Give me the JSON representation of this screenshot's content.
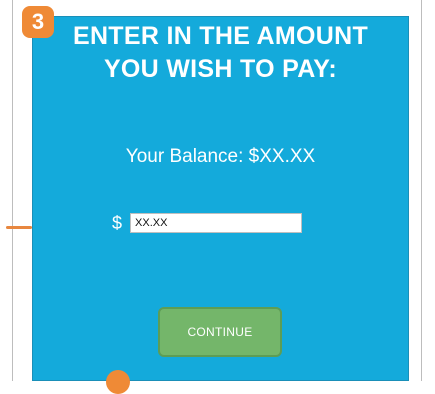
{
  "step": {
    "number": "3"
  },
  "header": {
    "title_line1": "ENTER IN THE AMOUNT",
    "title_line2": "YOU WISH TO PAY:"
  },
  "balance": {
    "text": "Your Balance: $XX.XX"
  },
  "payment": {
    "currency_symbol": "$",
    "amount_value": "XX.XX"
  },
  "actions": {
    "continue_label": "CONTINUE"
  },
  "colors": {
    "screen_bg": "#14aadb",
    "accent": "#ef8a36",
    "button_bg": "#74b66a"
  }
}
